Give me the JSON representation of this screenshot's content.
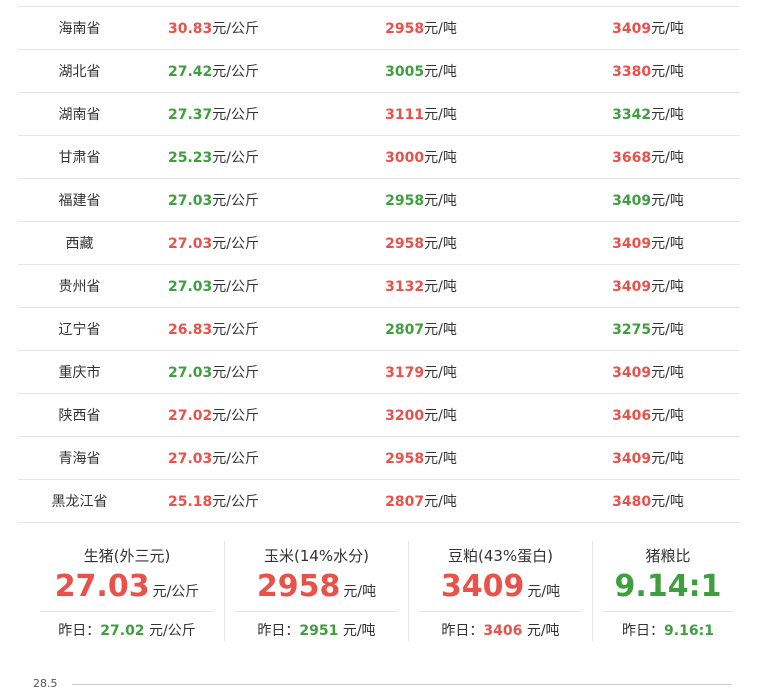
{
  "rows": [
    {
      "province": "海南省",
      "pig": "30.83",
      "pig_color": "red",
      "pig_unit": "元/公斤",
      "corn": "2958",
      "corn_color": "red",
      "corn_unit": "元/吨",
      "soy": "3409",
      "soy_color": "red",
      "soy_unit": "元/吨"
    },
    {
      "province": "湖北省",
      "pig": "27.42",
      "pig_color": "green",
      "pig_unit": "元/公斤",
      "corn": "3005",
      "corn_color": "green",
      "corn_unit": "元/吨",
      "soy": "3380",
      "soy_color": "red",
      "soy_unit": "元/吨"
    },
    {
      "province": "湖南省",
      "pig": "27.37",
      "pig_color": "green",
      "pig_unit": "元/公斤",
      "corn": "3111",
      "corn_color": "red",
      "corn_unit": "元/吨",
      "soy": "3342",
      "soy_color": "green",
      "soy_unit": "元/吨"
    },
    {
      "province": "甘肃省",
      "pig": "25.23",
      "pig_color": "green",
      "pig_unit": "元/公斤",
      "corn": "3000",
      "corn_color": "red",
      "corn_unit": "元/吨",
      "soy": "3668",
      "soy_color": "red",
      "soy_unit": "元/吨"
    },
    {
      "province": "福建省",
      "pig": "27.03",
      "pig_color": "green",
      "pig_unit": "元/公斤",
      "corn": "2958",
      "corn_color": "green",
      "corn_unit": "元/吨",
      "soy": "3409",
      "soy_color": "green",
      "soy_unit": "元/吨"
    },
    {
      "province": "西藏",
      "pig": "27.03",
      "pig_color": "red",
      "pig_unit": "元/公斤",
      "corn": "2958",
      "corn_color": "red",
      "corn_unit": "元/吨",
      "soy": "3409",
      "soy_color": "red",
      "soy_unit": "元/吨"
    },
    {
      "province": "贵州省",
      "pig": "27.03",
      "pig_color": "green",
      "pig_unit": "元/公斤",
      "corn": "3132",
      "corn_color": "red",
      "corn_unit": "元/吨",
      "soy": "3409",
      "soy_color": "red",
      "soy_unit": "元/吨"
    },
    {
      "province": "辽宁省",
      "pig": "26.83",
      "pig_color": "red",
      "pig_unit": "元/公斤",
      "corn": "2807",
      "corn_color": "green",
      "corn_unit": "元/吨",
      "soy": "3275",
      "soy_color": "green",
      "soy_unit": "元/吨"
    },
    {
      "province": "重庆市",
      "pig": "27.03",
      "pig_color": "green",
      "pig_unit": "元/公斤",
      "corn": "3179",
      "corn_color": "red",
      "corn_unit": "元/吨",
      "soy": "3409",
      "soy_color": "red",
      "soy_unit": "元/吨"
    },
    {
      "province": "陕西省",
      "pig": "27.02",
      "pig_color": "red",
      "pig_unit": "元/公斤",
      "corn": "3200",
      "corn_color": "red",
      "corn_unit": "元/吨",
      "soy": "3406",
      "soy_color": "red",
      "soy_unit": "元/吨"
    },
    {
      "province": "青海省",
      "pig": "27.03",
      "pig_color": "red",
      "pig_unit": "元/公斤",
      "corn": "2958",
      "corn_color": "red",
      "corn_unit": "元/吨",
      "soy": "3409",
      "soy_color": "red",
      "soy_unit": "元/吨"
    },
    {
      "province": "黑龙江省",
      "pig": "25.18",
      "pig_color": "red",
      "pig_unit": "元/公斤",
      "corn": "2807",
      "corn_color": "red",
      "corn_unit": "元/吨",
      "soy": "3480",
      "soy_color": "red",
      "soy_unit": "元/吨"
    }
  ],
  "summary": [
    {
      "title": "生猪(外三元)",
      "value": "27.03",
      "value_color": "red",
      "unit": "元/公斤",
      "prev_label": "昨日：",
      "prev_value": "27.02",
      "prev_color": "green",
      "prev_unit": " 元/公斤"
    },
    {
      "title": "玉米(14%水分)",
      "value": "2958",
      "value_color": "red",
      "unit": "元/吨",
      "prev_label": "昨日：",
      "prev_value": "2951",
      "prev_color": "green",
      "prev_unit": " 元/吨"
    },
    {
      "title": "豆粕(43%蛋白)",
      "value": "3409",
      "value_color": "red",
      "unit": "元/吨",
      "prev_label": "昨日：",
      "prev_value": "3406",
      "prev_color": "red",
      "prev_unit": " 元/吨"
    },
    {
      "title": "猪粮比",
      "value": "9.14:1",
      "value_color": "green",
      "unit": "",
      "prev_label": "昨日：",
      "prev_value": "9.16:1",
      "prev_color": "green",
      "prev_unit": ""
    }
  ],
  "chart": {
    "y_tick_top": "28.5"
  },
  "colors": {
    "red": "#e8524a",
    "green": "#3f9f3f"
  }
}
